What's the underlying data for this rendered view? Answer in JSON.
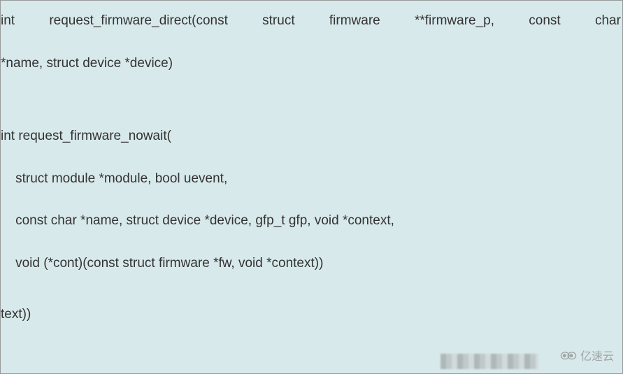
{
  "code": {
    "line1_parts": [
      "int",
      "request_firmware_direct(const",
      "struct",
      "firmware",
      "**firmware_p,",
      "const",
      "char"
    ],
    "line2": "*name, struct device *device)",
    "line3": "int request_firmware_nowait(",
    "line4": "    struct module *module, bool uevent,",
    "line5": "    const char *name, struct device *device, gfp_t gfp, void *context,",
    "line6": "    void (*cont)(const struct firmware *fw, void *context))",
    "line7": "text))"
  },
  "watermark": {
    "text": "亿速云"
  }
}
